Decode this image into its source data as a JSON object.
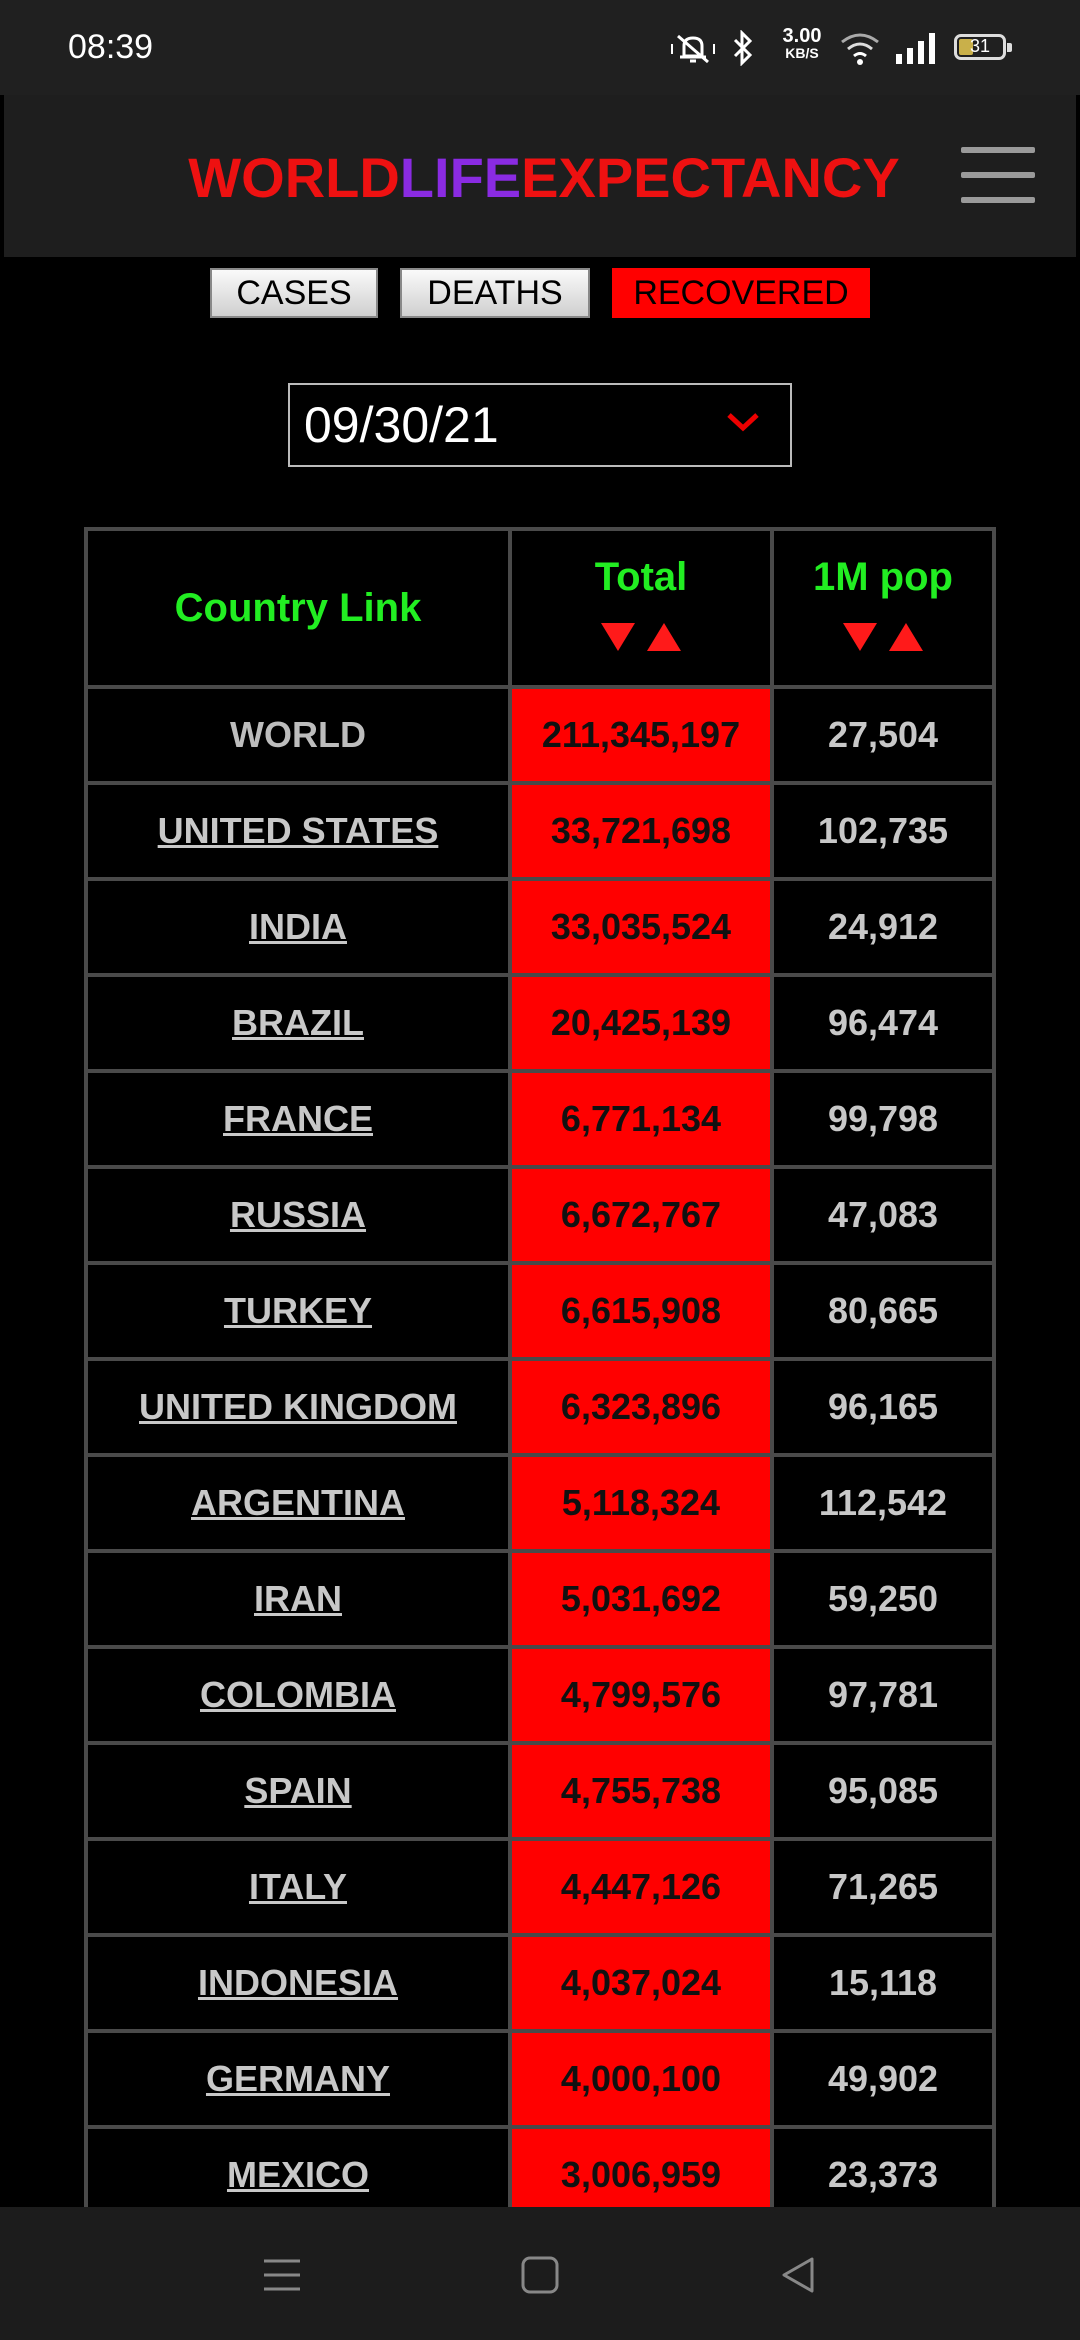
{
  "status_bar": {
    "time": "08:39",
    "net_speed_value": "3.00",
    "net_speed_unit": "KB/S",
    "battery": "31",
    "icons": [
      "mute-vibrate-icon",
      "bluetooth-icon",
      "wifi-icon",
      "signal-icon",
      "battery-icon"
    ]
  },
  "header": {
    "logo_part1": "WORLD",
    "logo_part2": "LIFE",
    "logo_part3": "EXPECTANCY",
    "menu_icon": "hamburger-menu-icon"
  },
  "tabs": [
    {
      "label": "CASES",
      "active": false
    },
    {
      "label": "DEATHS",
      "active": false
    },
    {
      "label": "RECOVERED",
      "active": true
    }
  ],
  "date_select": {
    "value": "09/30/21"
  },
  "table": {
    "headers": {
      "country": "Country Link",
      "total": "Total",
      "per_million": "1M pop"
    },
    "rows": [
      {
        "country": "WORLD",
        "total": "211,345,197",
        "per_million": "27,504"
      },
      {
        "country": "UNITED STATES",
        "total": "33,721,698",
        "per_million": "102,735"
      },
      {
        "country": "INDIA",
        "total": "33,035,524",
        "per_million": "24,912"
      },
      {
        "country": "BRAZIL",
        "total": "20,425,139",
        "per_million": "96,474"
      },
      {
        "country": "FRANCE",
        "total": "6,771,134",
        "per_million": "99,798"
      },
      {
        "country": "RUSSIA",
        "total": "6,672,767",
        "per_million": "47,083"
      },
      {
        "country": "TURKEY",
        "total": "6,615,908",
        "per_million": "80,665"
      },
      {
        "country": "UNITED KINGDOM",
        "total": "6,323,896",
        "per_million": "96,165"
      },
      {
        "country": "ARGENTINA",
        "total": "5,118,324",
        "per_million": "112,542"
      },
      {
        "country": "IRAN",
        "total": "5,031,692",
        "per_million": "59,250"
      },
      {
        "country": "COLOMBIA",
        "total": "4,799,576",
        "per_million": "97,781"
      },
      {
        "country": "SPAIN",
        "total": "4,755,738",
        "per_million": "95,085"
      },
      {
        "country": "ITALY",
        "total": "4,447,126",
        "per_million": "71,265"
      },
      {
        "country": "INDONESIA",
        "total": "4,037,024",
        "per_million": "15,118"
      },
      {
        "country": "GERMANY",
        "total": "4,000,100",
        "per_million": "49,902"
      },
      {
        "country": "MEXICO",
        "total": "3,006,959",
        "per_million": "23,373"
      }
    ]
  },
  "nav_bar": {
    "icons": [
      "recent-apps-icon",
      "home-icon",
      "back-icon"
    ]
  },
  "colors": {
    "accent_red": "#ff0000",
    "header_green": "#22ee22",
    "logo_purple": "#8a2be2"
  }
}
